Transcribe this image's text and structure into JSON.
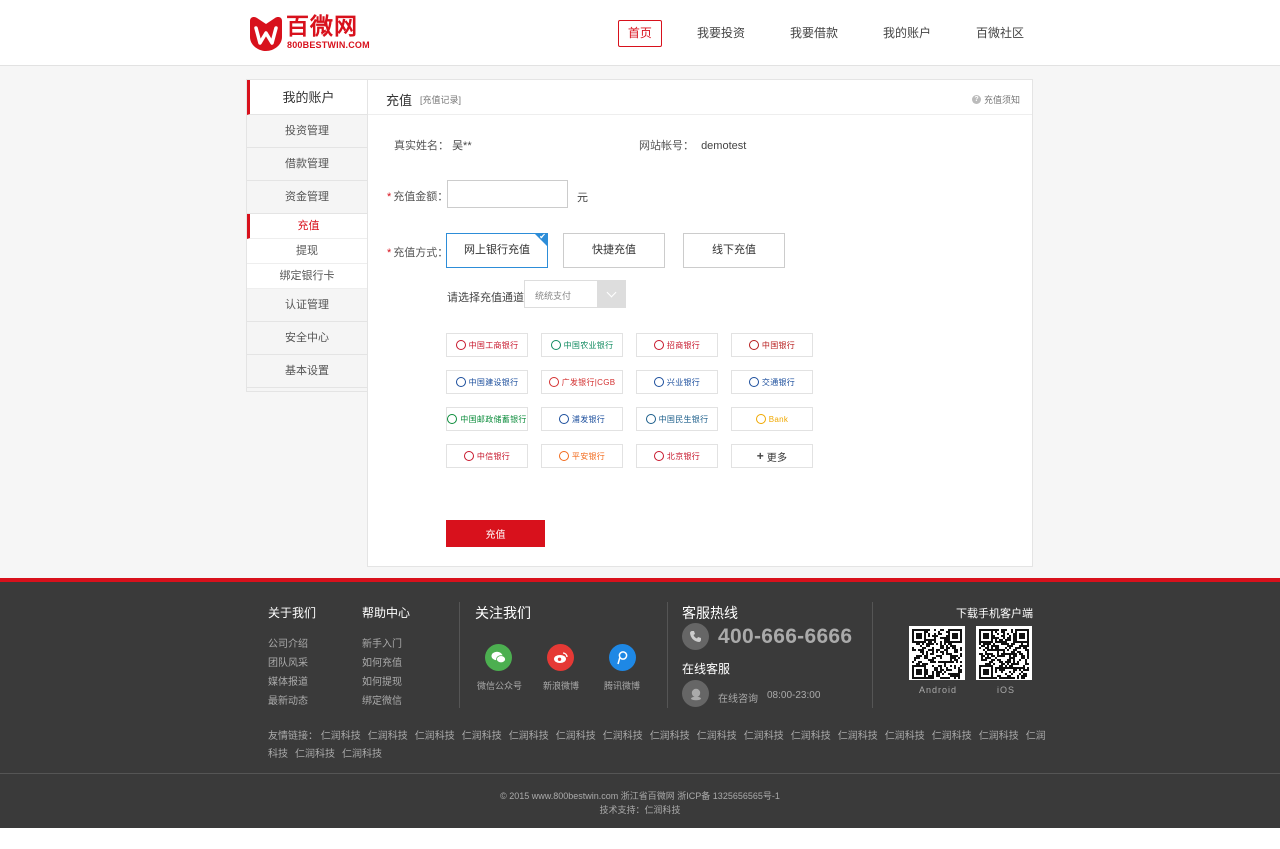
{
  "brand": {
    "name_cn": "百微网",
    "name_en": "800BESTWIN.COM",
    "color": "#d8111c"
  },
  "nav": [
    {
      "label": "首页",
      "active": true
    },
    {
      "label": "我要投资"
    },
    {
      "label": "我要借款"
    },
    {
      "label": "我的账户"
    },
    {
      "label": "百微社区"
    }
  ],
  "sidebar": {
    "title": "我的账户",
    "items": [
      {
        "label": "投资管理"
      },
      {
        "label": "借款管理"
      },
      {
        "label": "资金管理"
      }
    ],
    "sub_items": [
      {
        "label": "充值",
        "active": true
      },
      {
        "label": "提现"
      },
      {
        "label": "绑定银行卡"
      }
    ],
    "items_after": [
      {
        "label": "认证管理"
      },
      {
        "label": "安全中心"
      },
      {
        "label": "基本设置"
      }
    ]
  },
  "recharge": {
    "title": "充值",
    "records_link": "[充值记录]",
    "notice": "充值须知",
    "real_name_label": "真实姓名：",
    "real_name_value": "吴**",
    "account_label": "网站帐号：",
    "account_value": "demotest",
    "amount_label": "充值金额：",
    "amount_value": "",
    "amount_unit": "元",
    "method_label": "充值方式：",
    "methods": [
      {
        "label": "网上银行充值",
        "active": true
      },
      {
        "label": "快捷充值"
      },
      {
        "label": "线下充值"
      }
    ],
    "channel_label": "请选择充值通道",
    "channel_selected": "统统支付",
    "submit_label": "充值"
  },
  "banks": [
    {
      "name": "中国工商银行",
      "color": "#c7162b"
    },
    {
      "name": "中国农业银行",
      "color": "#0f8a5f"
    },
    {
      "name": "招商银行",
      "color": "#c7162b"
    },
    {
      "name": "中国银行",
      "color": "#b71c1c"
    },
    {
      "name": "中国建设银行",
      "color": "#1a4d9c"
    },
    {
      "name": "广发银行|CGB",
      "color": "#d32f2f"
    },
    {
      "name": "兴业银行",
      "color": "#1a4d9c"
    },
    {
      "name": "交通银行",
      "color": "#1a4d9c"
    },
    {
      "name": "中国邮政储蓄银行",
      "color": "#0b8c3b"
    },
    {
      "name": "浦发银行",
      "color": "#1a4d9c"
    },
    {
      "name": "中国民生银行",
      "color": "#1a5d8a"
    },
    {
      "name": "Bank",
      "color": "#f0a800"
    },
    {
      "name": "中信银行",
      "color": "#c7162b"
    },
    {
      "name": "平安银行",
      "color": "#f26a1b"
    },
    {
      "name": "北京银行",
      "color": "#c7162b"
    },
    {
      "name": "更多",
      "more": true
    }
  ],
  "footer": {
    "about": {
      "title": "关于我们",
      "links": [
        "公司介绍",
        "团队风采",
        "媒体报道",
        "最新动态"
      ]
    },
    "help": {
      "title": "帮助中心",
      "links": [
        "新手入门",
        "如何充值",
        "如何提现",
        "绑定微信"
      ]
    },
    "follow": {
      "title": "关注我们",
      "items": [
        {
          "label": "微信公众号",
          "color": "#4caf50",
          "icon": "wechat-icon"
        },
        {
          "label": "新浪微博",
          "color": "#e53935",
          "icon": "weibo-icon"
        },
        {
          "label": "腾讯微博",
          "color": "#1e88e5",
          "icon": "tencent-weibo-icon"
        }
      ]
    },
    "hotline_title": "客服热线",
    "phone": "400-666-6666",
    "online_title": "在线客服",
    "online_label": "在线咨询",
    "online_hours": "08:00-23:00",
    "download_title": "下载手机客户端",
    "apps": [
      "Android",
      "iOS"
    ],
    "friend_label": "友情链接：",
    "friend_links": [
      "仁润科技",
      "仁润科技",
      "仁润科技",
      "仁润科技",
      "仁润科技",
      "仁润科技",
      "仁润科技",
      "仁润科技",
      "仁润科技",
      "仁润科技",
      "仁润科技",
      "仁润科技",
      "仁润科技",
      "仁润科技",
      "仁润科技",
      "仁润科技",
      "仁润科技",
      "仁润科技"
    ],
    "copyright": "© 2015 www.800bestwin.com  浙江省百微网  浙ICP备 1325656565号-1",
    "tech_support": "技术支持：仁润科技"
  }
}
